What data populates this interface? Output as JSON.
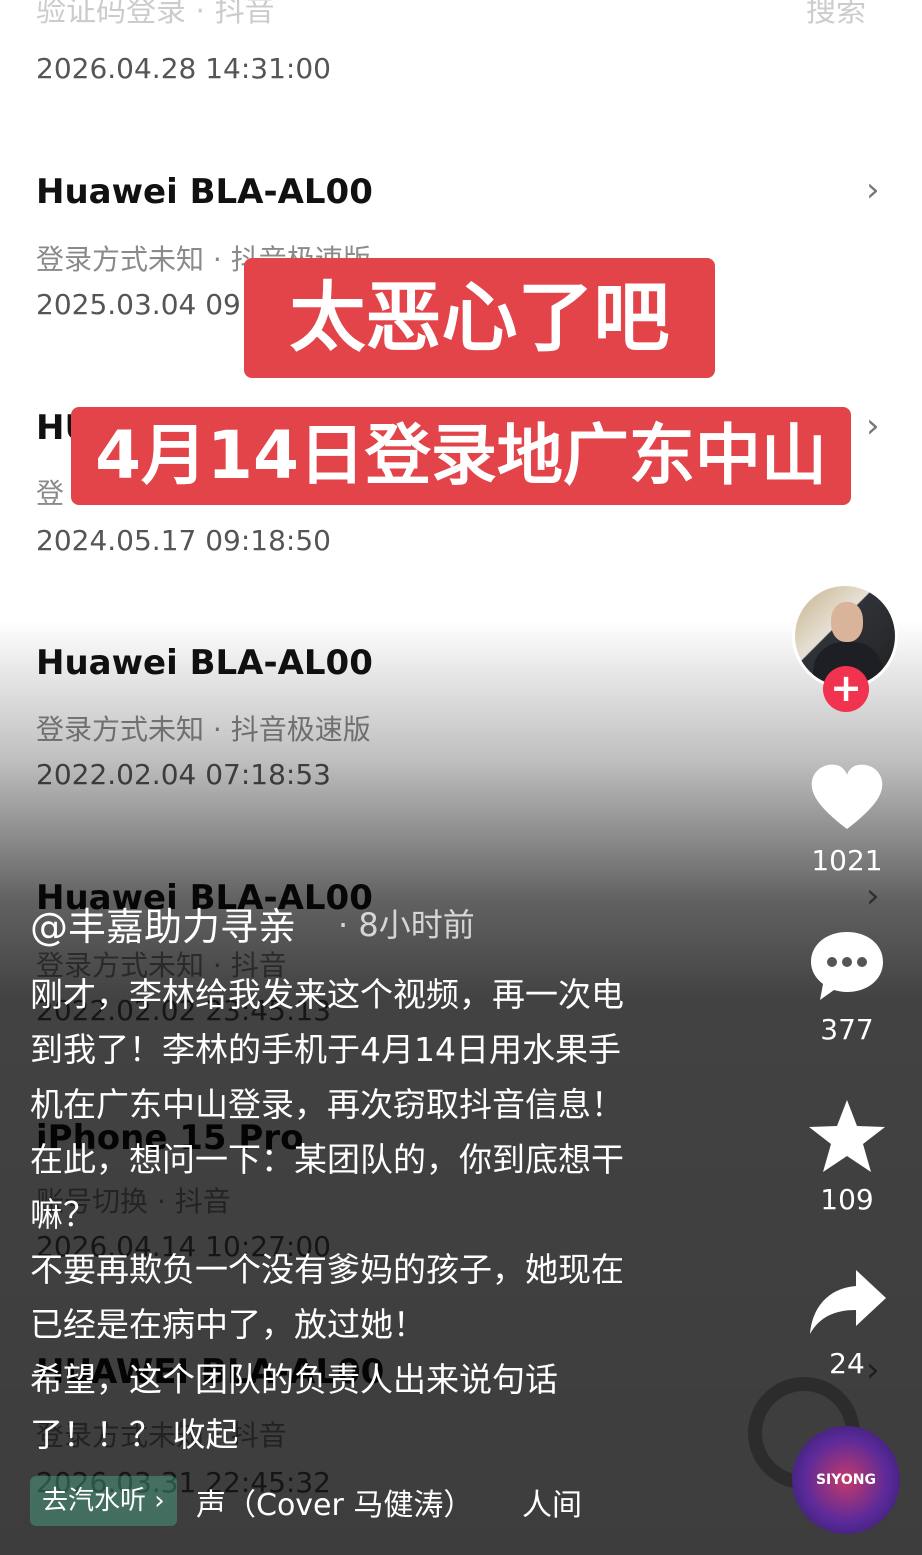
{
  "background_list": {
    "top_ghost_left": "验证码登录 · 抖音",
    "top_ghost_search": "搜索",
    "items": [
      {
        "title": "",
        "subtitle": "验证码登录 · 抖音",
        "date": "2026.04.28 14:31:00"
      },
      {
        "title": "Huawei BLA-AL00",
        "subtitle": "登录方式未知 · 抖音极速版",
        "date": "2025.03.04 09"
      },
      {
        "title": "HU",
        "subtitle": "登",
        "date": "2024.05.17 09:18:50"
      },
      {
        "title": "Huawei BLA-AL00",
        "subtitle": "登录方式未知 · 抖音极速版",
        "date": "2022.02.04 07:18:53"
      },
      {
        "title": "Huawei BLA-AL00",
        "subtitle": "登录方式未知 · 抖音",
        "date": "2022.02.02 23:45:13"
      },
      {
        "title": "iPhone 15 Pro",
        "subtitle": "账号切换 · 抖音",
        "date": "2026.04.14 10:27:00"
      },
      {
        "title": "HUAWEI BLA-AL00",
        "subtitle": "登录方式未知 · 抖音",
        "date": "2026.03.31 22:45:32"
      }
    ]
  },
  "banners": {
    "line1": "太恶心了吧",
    "line2": "4月14日登录地广东中山"
  },
  "rail": {
    "like_count": "1021",
    "comment_count": "377",
    "favorite_count": "109",
    "share_count": "24"
  },
  "caption": {
    "author": "@丰嘉助力寻亲",
    "time": "· 8小时前",
    "lines": [
      "刚才，李林给我发来这个视频，再一次电",
      "到我了！李林的手机于4月14日用水果手",
      "机在广东中山登录，再次窃取抖音信息！",
      "在此，想问一下：某团队的，你到底想干",
      "嘛？",
      "不要再欺负一个没有爹妈的孩子，她现在",
      "已经是在病中了，放过她！",
      "希望，这个团队的负责人出来说句话",
      "了！！？ "
    ],
    "collapse_label": "收起"
  },
  "music": {
    "chip_label": "去汽水听 ›",
    "title": "声（Cover 马健涛）",
    "title2": "人间",
    "disc_label": "SIYONG"
  },
  "colors": {
    "banner_red": "#e2444a",
    "follow_red": "#f2334f"
  }
}
